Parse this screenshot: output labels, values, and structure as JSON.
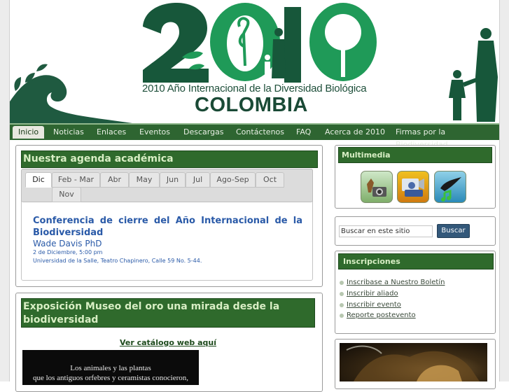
{
  "header": {
    "logo_year": "2010",
    "logo_subtitle": "2010 Año Internacional de la Diversidad Biológica",
    "logo_country": "COLOMBIA",
    "brand_dark": "#17573a",
    "brand_light": "#1f9a58"
  },
  "nav": {
    "items": [
      {
        "label": "Inicio",
        "active": true
      },
      {
        "label": "Noticias"
      },
      {
        "label": "Enlaces"
      },
      {
        "label": "Eventos"
      },
      {
        "label": "Descargas"
      },
      {
        "label": "Contáctenos"
      },
      {
        "label": "FAQ"
      },
      {
        "label": "Acerca de 2010"
      },
      {
        "label": "Firmas por la Biodiversidad"
      }
    ]
  },
  "agenda": {
    "title": "Nuestra agenda académica",
    "tabs": [
      "Dic",
      "Feb - Mar",
      "Abr",
      "May",
      "Jun",
      "Jul",
      "Ago-Sep",
      "Oct",
      "Nov"
    ],
    "event_title": "Conferencia de cierre del Año Internacional de la Biodiversidad",
    "speaker": "Wade Davis PhD",
    "date": "2 de Diciembre, 5:00 pm",
    "location": "Universidad de la Salle, Teatro Chapinero, Calle 59 No. 5-44."
  },
  "exposicion": {
    "title": "Exposición Museo del oro una mirada desde la biodiversidad",
    "catalog_link": "Ver catálogo web aquí",
    "banner_line1": "Los animales y las plantas",
    "banner_line2": "que los antiguos orfebres y ceramistas conocieron,"
  },
  "sidebar": {
    "multimedia_title": "Multimedia",
    "multimedia_icons": [
      "photo-camera-icon",
      "video-icon",
      "audio-icon"
    ],
    "search_placeholder": "Buscar en este sitio",
    "search_button": "Buscar",
    "inscripciones_title": "Inscripciones",
    "inscripciones_links": [
      "Inscribase a Nuestro Boletín",
      "Inscribir aliado",
      "Inscribir evento",
      "Reporte postevento"
    ]
  }
}
